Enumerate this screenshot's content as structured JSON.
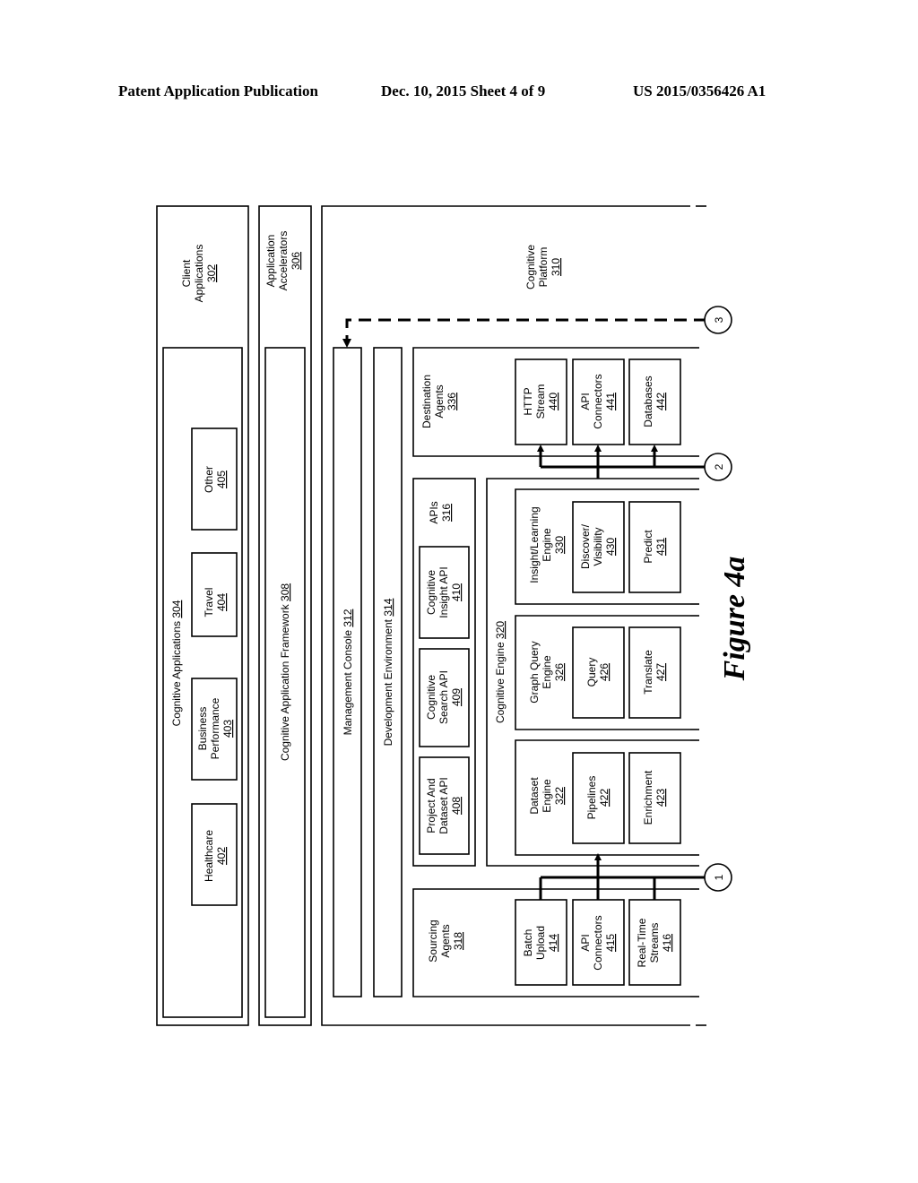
{
  "header": {
    "publication": "Patent Application Publication",
    "date_sheet": "Dec. 10, 2015   Sheet 4 of 9",
    "patent_number": "US 2015/0356426 A1"
  },
  "figure_label": "Figure 4a",
  "client_applications": {
    "label": "Client Applications",
    "ref": "302"
  },
  "cognitive_applications": {
    "label": "Cognitive Applications",
    "ref": "304",
    "items": [
      {
        "lines": [
          "Healthcare"
        ],
        "ref": "402"
      },
      {
        "lines": [
          "Business",
          "Performance"
        ],
        "ref": "403"
      },
      {
        "lines": [
          "Travel"
        ],
        "ref": "404"
      },
      {
        "lines": [
          "Other"
        ],
        "ref": "405"
      }
    ]
  },
  "application_accelerators": {
    "lines": [
      "Application",
      "Accelerators"
    ],
    "ref": "306"
  },
  "cognitive_application_framework": {
    "label": "Cognitive Application Framework",
    "ref": "308"
  },
  "cognitive_platform": {
    "lines": [
      "Cognitive",
      "Platform"
    ],
    "ref": "310"
  },
  "management_console": {
    "label": "Management Console",
    "ref": "312"
  },
  "development_environment": {
    "label": "Development Environment",
    "ref": "314"
  },
  "apis": {
    "label": "APIs",
    "ref": "316",
    "items": [
      {
        "lines": [
          "Project And",
          "Dataset API"
        ],
        "ref": "408"
      },
      {
        "lines": [
          "Cognitive",
          "Search API"
        ],
        "ref": "409"
      },
      {
        "lines": [
          "Cognitive",
          "Insight API"
        ],
        "ref": "410"
      }
    ]
  },
  "sourcing_agents": {
    "lines": [
      "Sourcing",
      "Agents"
    ],
    "ref": "318",
    "items": [
      {
        "lines": [
          "Batch",
          "Upload"
        ],
        "ref": "414"
      },
      {
        "lines": [
          "API",
          "Connectors"
        ],
        "ref": "415"
      },
      {
        "lines": [
          "Real-Time",
          "Streams"
        ],
        "ref": "416"
      }
    ]
  },
  "cognitive_engine": {
    "label": "Cognitive Engine",
    "ref": "320"
  },
  "dataset_engine": {
    "lines": [
      "Dataset",
      "Engine"
    ],
    "ref": "322",
    "items": [
      {
        "lines": [
          "Pipelines"
        ],
        "ref": "422"
      },
      {
        "lines": [
          "Enrichment"
        ],
        "ref": "423"
      }
    ]
  },
  "graph_query_engine": {
    "lines": [
      "Graph Query",
      "Engine"
    ],
    "ref": "326",
    "items": [
      {
        "lines": [
          "Query"
        ],
        "ref": "426"
      },
      {
        "lines": [
          "Translate"
        ],
        "ref": "427"
      }
    ]
  },
  "insight_learning_engine": {
    "lines": [
      "Insight/Learning",
      "Engine"
    ],
    "ref": "330",
    "items": [
      {
        "lines": [
          "Discover/",
          "Visibility"
        ],
        "ref": "430"
      },
      {
        "lines": [
          "Predict"
        ],
        "ref": "431"
      }
    ]
  },
  "destination_agents": {
    "lines": [
      "Destination",
      "Agents"
    ],
    "ref": "336",
    "items": [
      {
        "lines": [
          "HTTP",
          "Stream"
        ],
        "ref": "440"
      },
      {
        "lines": [
          "API",
          "Connectors"
        ],
        "ref": "441"
      },
      {
        "lines": [
          "Databases"
        ],
        "ref": "442"
      }
    ]
  },
  "connectors": [
    "1",
    "2",
    "3"
  ]
}
